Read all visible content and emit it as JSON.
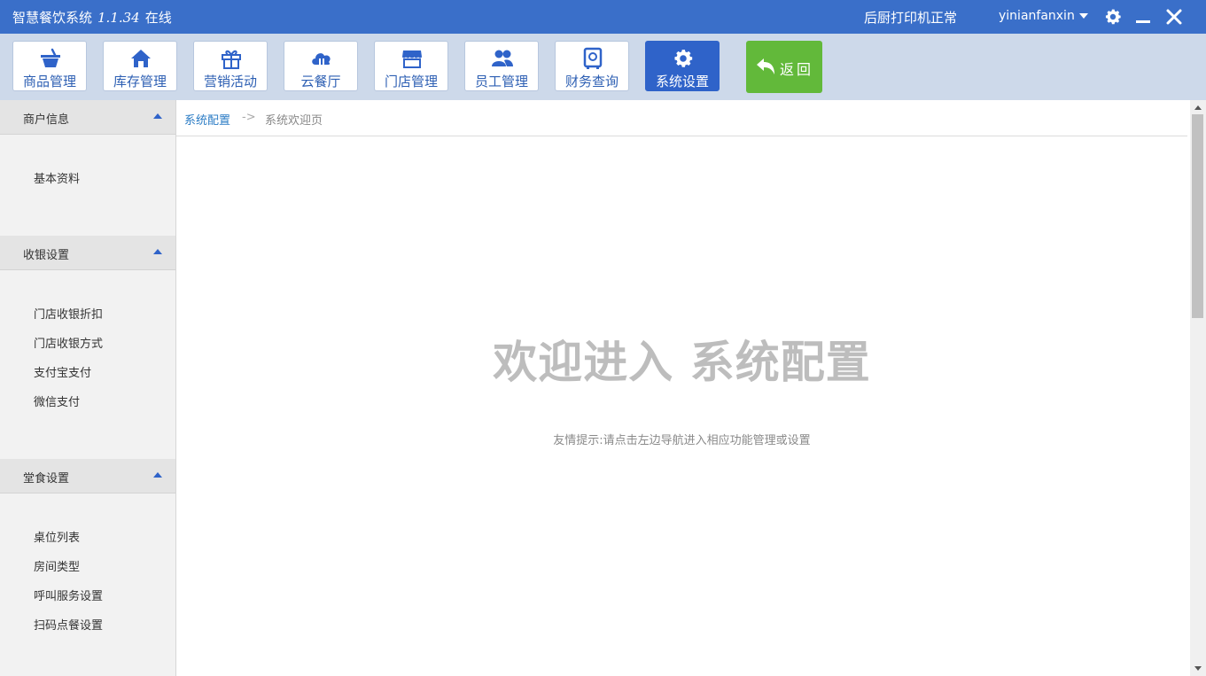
{
  "titlebar": {
    "app_name": "智慧餐饮系统",
    "version": "1.1.34",
    "status": "在线",
    "printer_status": "后厨打印机正常",
    "username": "yinianfanxin"
  },
  "toolbar": {
    "items": [
      {
        "label": "商品管理",
        "icon": "basket-icon"
      },
      {
        "label": "库存管理",
        "icon": "home-icon"
      },
      {
        "label": "营销活动",
        "icon": "gift-icon"
      },
      {
        "label": "云餐厅",
        "icon": "cloud-cutlery-icon"
      },
      {
        "label": "门店管理",
        "icon": "storefront-icon"
      },
      {
        "label": "员工管理",
        "icon": "users-icon"
      },
      {
        "label": "财务查询",
        "icon": "safe-icon"
      },
      {
        "label": "系统设置",
        "icon": "gear-icon",
        "active": true
      }
    ],
    "back_label": "返回"
  },
  "sidebar": {
    "sections": [
      {
        "title": "商户信息",
        "items": [
          "基本资料"
        ]
      },
      {
        "title": "收银设置",
        "items": [
          "门店收银折扣",
          "门店收银方式",
          "支付宝支付",
          "微信支付"
        ]
      },
      {
        "title": "堂食设置",
        "items": [
          "桌位列表",
          "房间类型",
          "呼叫服务设置",
          "扫码点餐设置"
        ]
      }
    ]
  },
  "main": {
    "breadcrumb": {
      "parent": "系统配置",
      "separator": "->",
      "current": "系统欢迎页"
    },
    "welcome": "欢迎进入 系统配置",
    "hint": "友情提示:请点击左边导航进入相应功能管理或设置"
  },
  "colors": {
    "titlebar": "#3a6fc9",
    "toolbar_bg": "#cdd9ea",
    "accent": "#2f63c9",
    "back_button": "#62b93a",
    "link": "#2b7cc5"
  }
}
